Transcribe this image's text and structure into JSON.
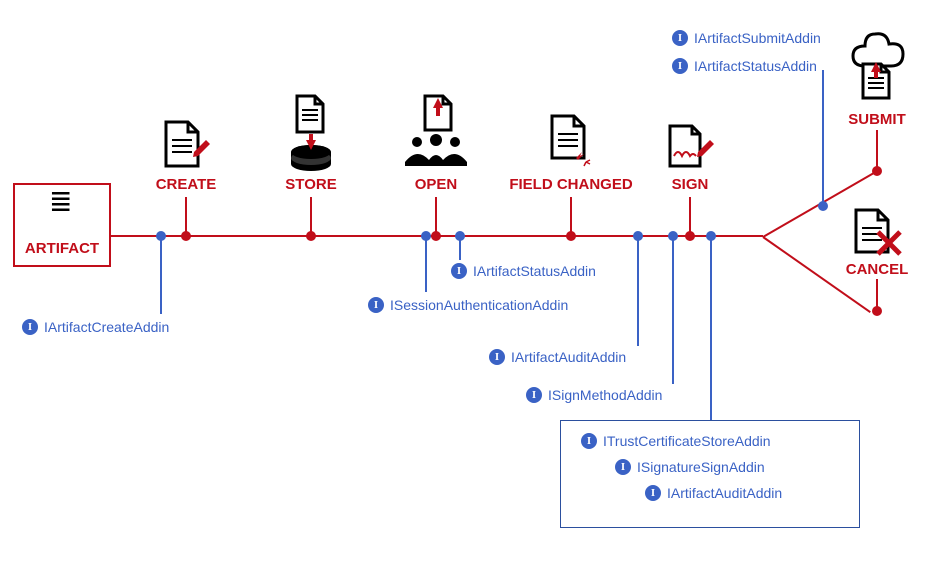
{
  "artifact": {
    "label": "ARTIFACT"
  },
  "stages": {
    "create": {
      "label": "CREATE"
    },
    "store": {
      "label": "STORE"
    },
    "open": {
      "label": "OPEN"
    },
    "field_changed": {
      "label": "FIELD CHANGED"
    },
    "sign": {
      "label": "SIGN"
    },
    "submit": {
      "label": "SUBMIT"
    },
    "cancel": {
      "label": "CANCEL"
    }
  },
  "interfaces": {
    "artifact_create": "IArtifactCreateAddin",
    "session_auth": "ISessionAuthenticationAddin",
    "artifact_status": "IArtifactStatusAddin",
    "artifact_audit": "IArtifactAuditAddin",
    "sign_method": "ISignMethodAddin",
    "trust_cert": "ITrustCertificateStoreAddin",
    "signature_sign": "ISignatureSignAddin",
    "artifact_submit": "IArtifactSubmitAddin"
  },
  "badge_glyph": "I"
}
